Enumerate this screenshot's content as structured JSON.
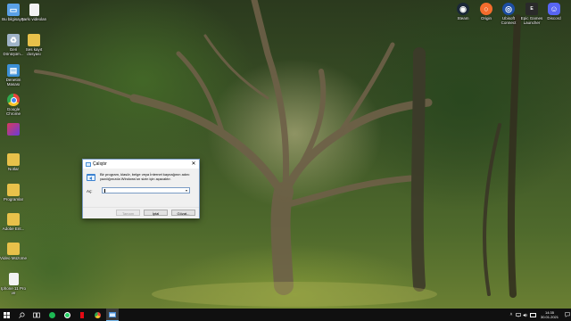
{
  "desktop": {
    "left_icons": [
      {
        "label": "Bu bilgisayar",
        "icon": "computer-icon",
        "color": "#5aa0e6"
      },
      {
        "label": "Geri Dönüşüm...",
        "icon": "recycle-bin-icon",
        "color": "#9fb3c8"
      },
      {
        "label": "Denetim Masası",
        "icon": "control-panel-icon",
        "color": "#3c8fd6"
      },
      {
        "label": "Google Chrome",
        "icon": "chrome-icon",
        "color": "#e8453c"
      },
      {
        "label": "",
        "icon": "app-icon",
        "color": "#d83b5c"
      },
      {
        "label": "Notlar",
        "icon": "folder-icon",
        "color": "#e8c14a"
      },
      {
        "label": "Programlar",
        "icon": "folder-icon",
        "color": "#e8c14a"
      },
      {
        "label": "Adobe Ent...",
        "icon": "folder-icon",
        "color": "#e8c14a"
      },
      {
        "label": "Video Müzüme",
        "icon": "folder-icon",
        "color": "#e8c14a"
      },
      {
        "label": "Iphone 11 Pro ve",
        "icon": "document-icon",
        "color": "#f2f2f2"
      }
    ],
    "second_column": [
      {
        "label": "Şarkı videoları",
        "icon": "document-icon",
        "color": "#f2f2f2"
      },
      {
        "label": "Ses kayıt dosyası",
        "icon": "folder-icon",
        "color": "#e8c14a"
      }
    ],
    "right_icons": [
      {
        "label": "Steam",
        "icon": "steam-icon",
        "color": "#1b2838"
      },
      {
        "label": "Origin",
        "icon": "origin-icon",
        "color": "#f56c2d"
      },
      {
        "label": "Ubisoft Connect",
        "icon": "ubisoft-icon",
        "color": "#1c4da1"
      },
      {
        "label": "Epic Games Launcher",
        "icon": "epic-games-icon",
        "color": "#2a2a2a"
      },
      {
        "label": "Discord",
        "icon": "discord-icon",
        "color": "#5865f2"
      }
    ]
  },
  "run_dialog": {
    "title": "Çalıştır",
    "close_glyph": "✕",
    "description": "Bir program, klasör, belge veya İnternet kaynağının adını yazdığınızda Windows'un sizin için açacaktır.",
    "open_label": "Aç:",
    "input_value": "",
    "buttons": {
      "ok": "Tamam",
      "cancel": "İptal",
      "browse": "Gözat..."
    }
  },
  "taskbar": {
    "pinned": [
      "start-icon",
      "search-icon",
      "task-view-icon",
      "spotify-icon",
      "whatsapp-icon",
      "netflix-icon",
      "chrome-icon",
      "run-icon"
    ],
    "clock": {
      "time": "14:35",
      "date": "30.01.2021"
    },
    "accent": "#76b9ed"
  }
}
